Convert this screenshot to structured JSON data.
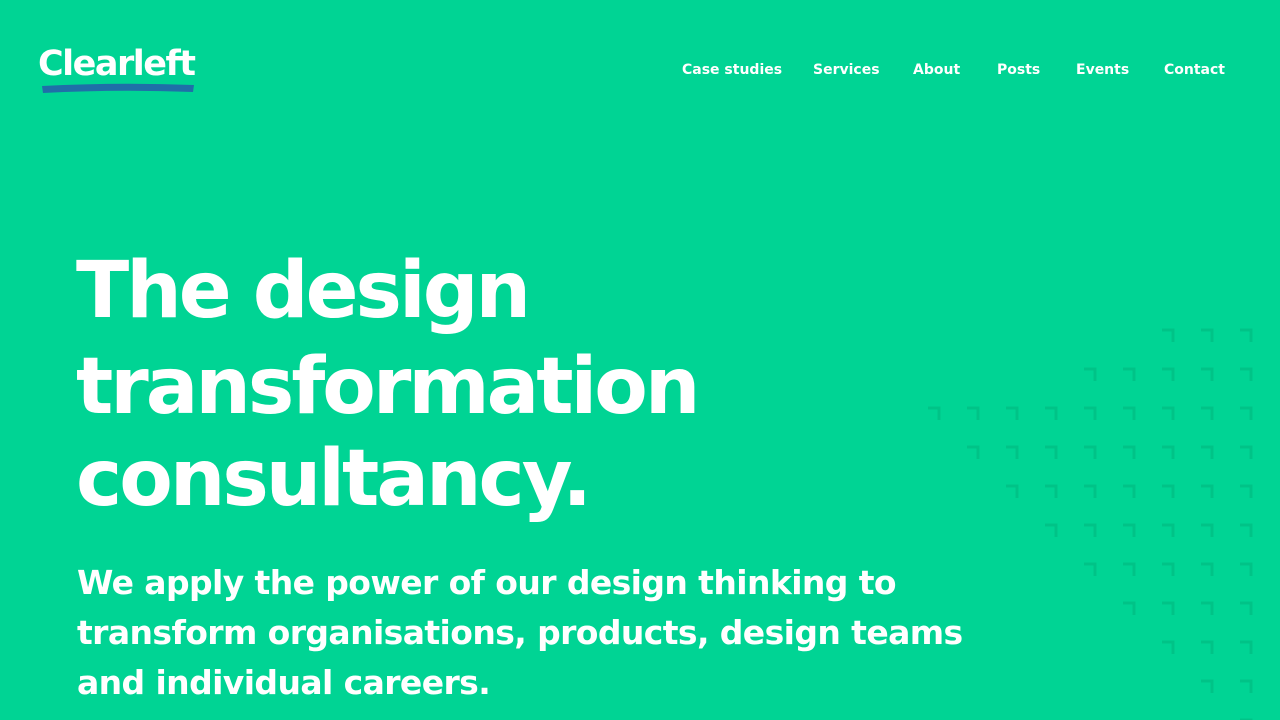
{
  "logo": {
    "text": "Clearleft"
  },
  "nav": {
    "items": [
      {
        "label": "Case studies"
      },
      {
        "label": "Services"
      },
      {
        "label": "About"
      },
      {
        "label": "Posts"
      },
      {
        "label": "Events"
      },
      {
        "label": "Contact"
      }
    ]
  },
  "hero": {
    "headline_lines": [
      "The design",
      "transformation",
      "consultancy."
    ],
    "intro_lines": [
      "We apply the power of our design thinking to",
      "transform organisations, products, design teams",
      "and individual careers."
    ]
  },
  "colors": {
    "background": "#00d494",
    "text": "#ffffff",
    "logo_swoosh": "#1f6fa8",
    "pattern_mark": "#00c387"
  }
}
